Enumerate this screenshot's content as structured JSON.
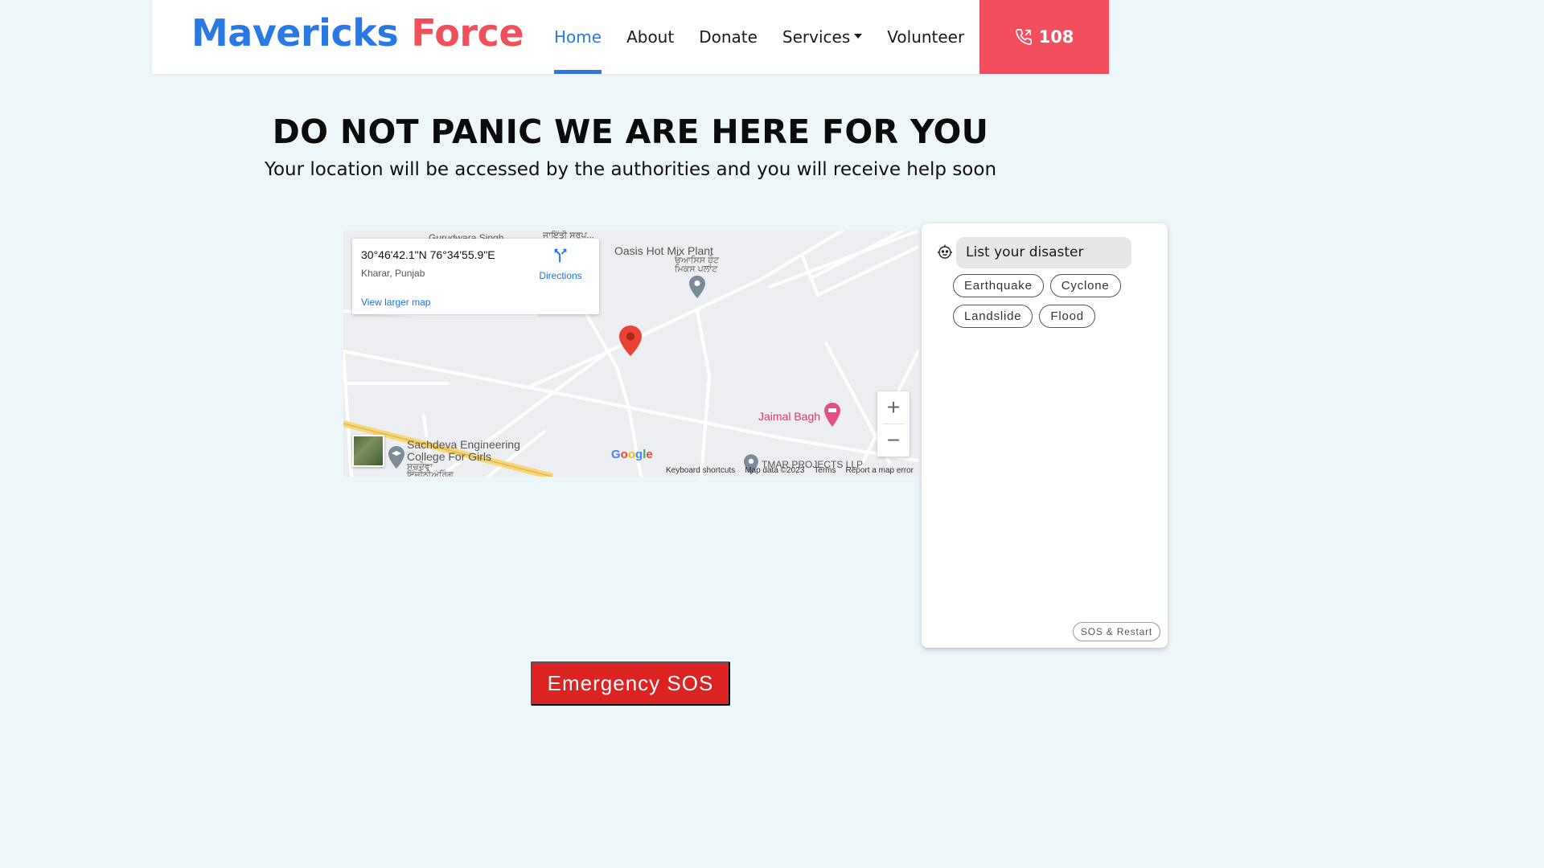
{
  "brand": {
    "part1": "Mavericks",
    "part2": "Force"
  },
  "nav": {
    "home": "Home",
    "about": "About",
    "donate": "Donate",
    "services": "Services",
    "volunteer": "Volunteer"
  },
  "phone": {
    "number": "108",
    "icon": "phone-icon"
  },
  "hero": {
    "headline": "DO NOT PANIC WE ARE HERE FOR YOU",
    "subline": "Your location will be accessed by the authorities and you will receive help soon"
  },
  "map": {
    "coords": "30°46'42.1\"N 76°34'55.9\"E",
    "location": "Kharar, Punjab",
    "larger_map": "View larger map",
    "directions": "Directions",
    "labels": {
      "gurudwara": "Gurudwara Singh",
      "punjabi_top": "ਜਾਇੰਤੀ ਸਰੂਪ...",
      "oasis": "Oasis Hot Mix Plant",
      "oasis_pa": "ਓਆਸਿਸ ਹੌਟ",
      "oasis_pa2": "ਮਿਕਸ ਪਲਾਂਟ",
      "jaimal": "Jaimal Bagh",
      "sachdeva1": "Sachdeva Engineering",
      "sachdeva2": "College For Girls",
      "sachdeva_pa1": "ਸਚਦੇਵਾ",
      "sachdeva_pa2": "ਇੰਜੀਨੀਅਰਿੰਗ",
      "tmar": "TMAR PROJECTS LLP",
      "google": "Google"
    },
    "attribution": {
      "shortcuts": "Keyboard shortcuts",
      "data": "Map data ©2023",
      "terms": "Terms",
      "report": "Report a map error"
    },
    "zoom_in": "+",
    "zoom_out": "−"
  },
  "chat": {
    "prompt": "List your disaster",
    "options": [
      "Earthquake",
      "Cyclone",
      "Landslide",
      "Flood"
    ],
    "restart": "SOS & Restart"
  },
  "emergency": {
    "label": "Emergency SOS"
  },
  "colors": {
    "brand_blue": "#2a78e4",
    "brand_red": "#f0505c",
    "phone_bg": "#f34e5e",
    "emergency_bg": "#dd2222",
    "page_bg": "#edf6f9"
  }
}
